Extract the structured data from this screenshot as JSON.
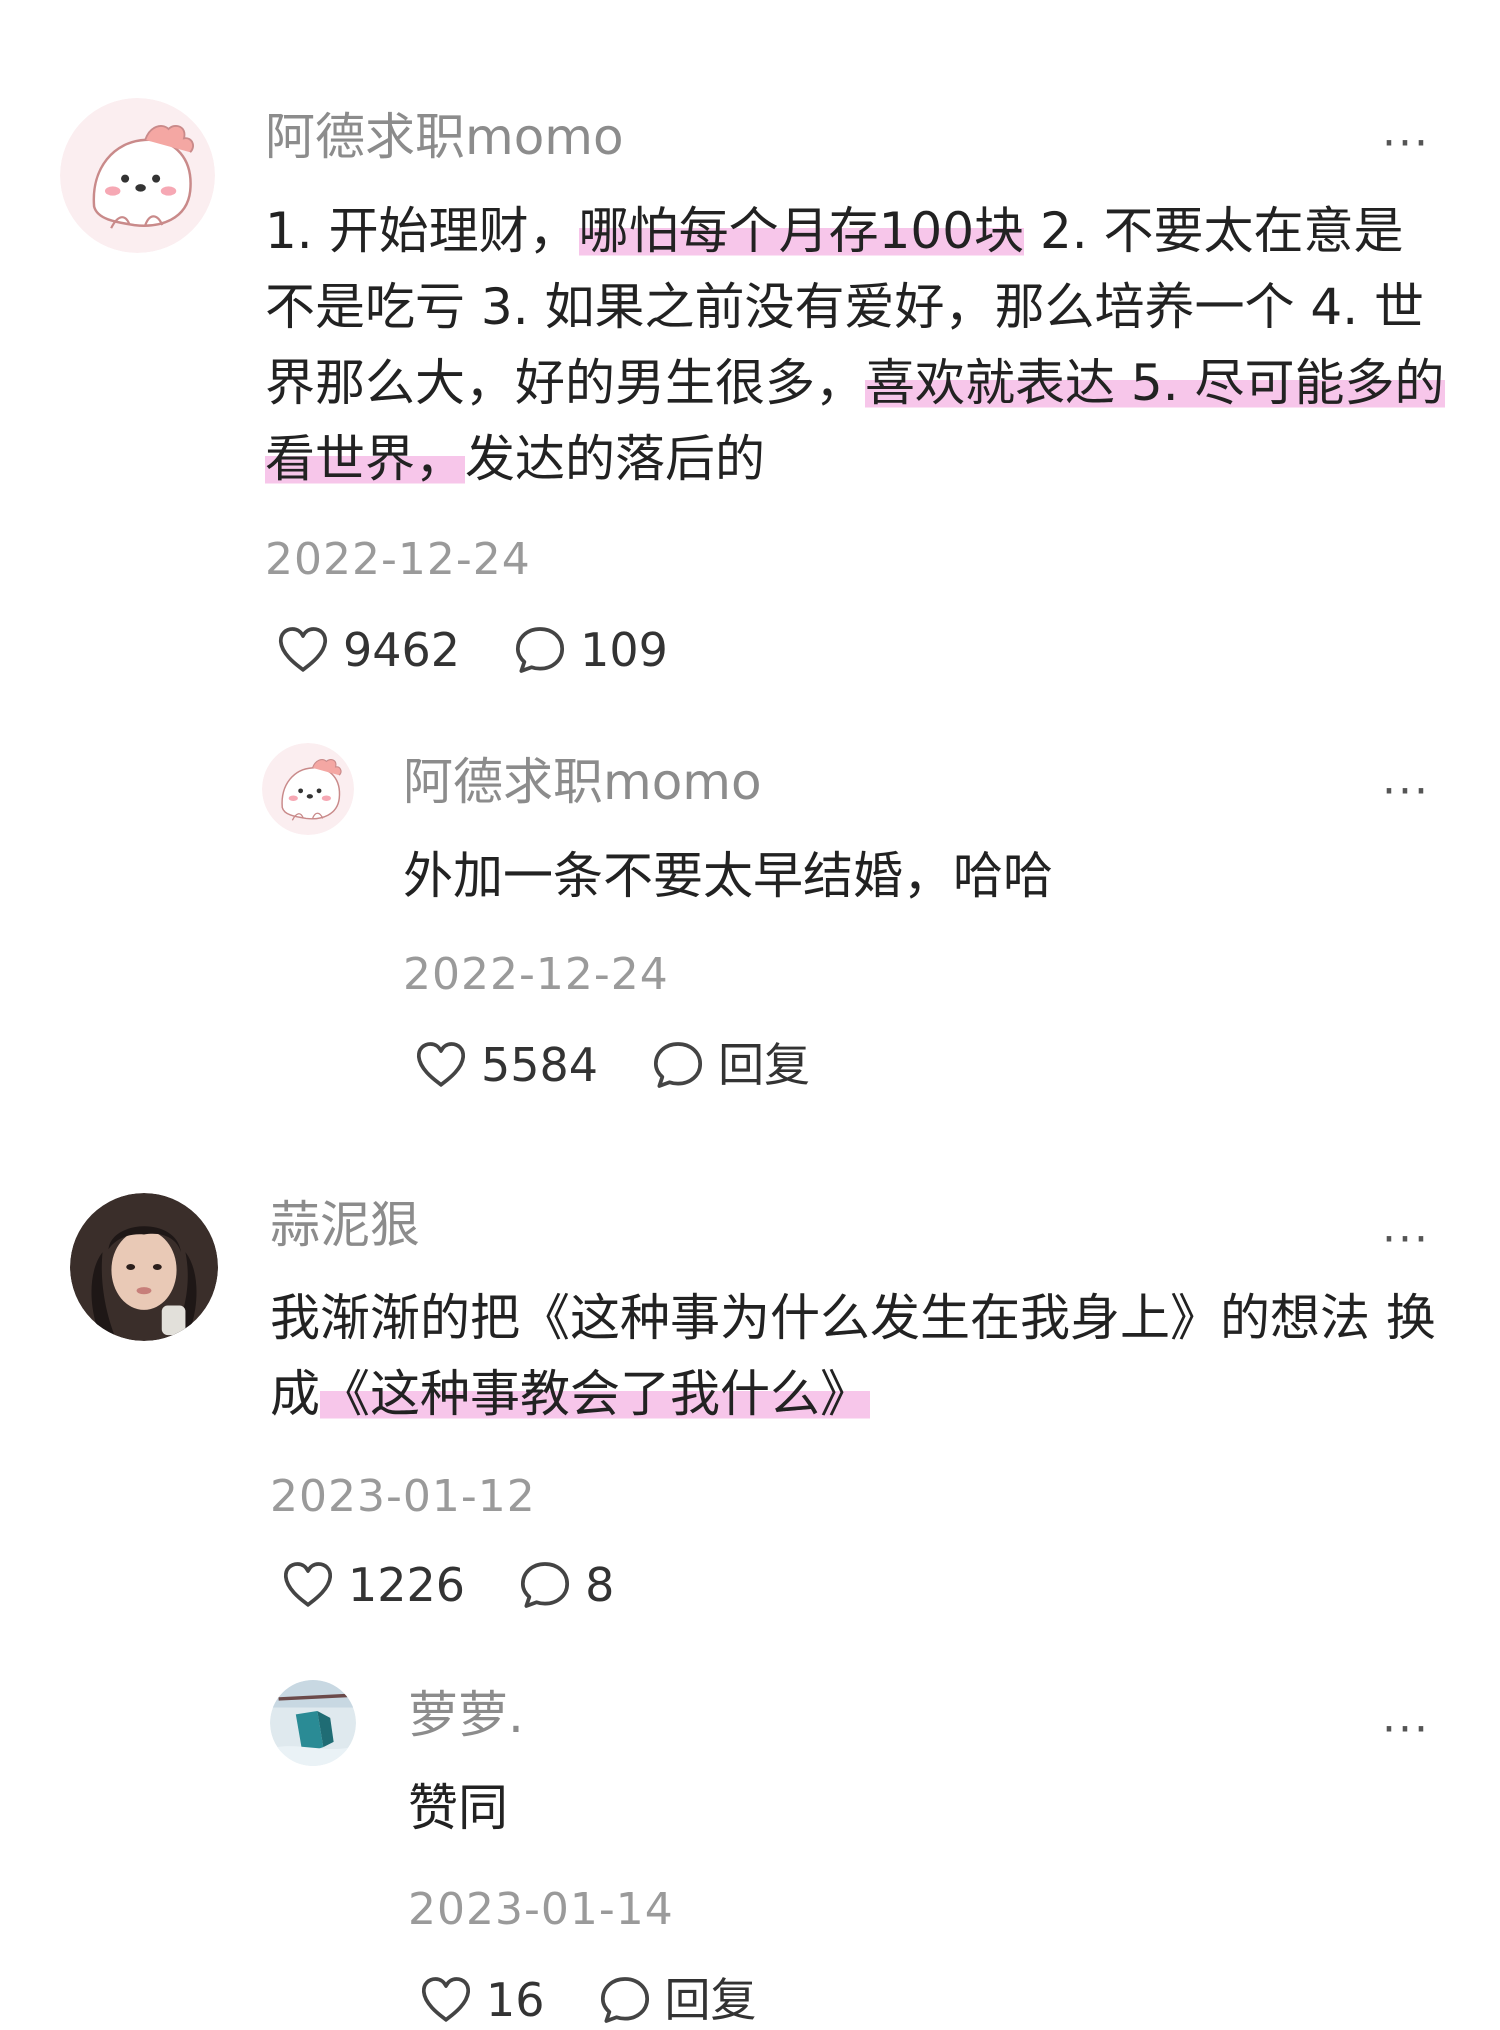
{
  "comments": [
    {
      "username": "阿德求职momo",
      "more": "···",
      "content": [
        {
          "text": "1. 开始理财，",
          "hl": false
        },
        {
          "text": "哪怕每个月存100块",
          "hl": true
        },
        {
          "text": " 2. 不要太在意是不是吃亏 3. 如果之前没有爱好，那么培养一个 4. 世界那么大，好的男生很多，",
          "hl": false
        },
        {
          "text": "喜欢就表达 5. 尽可能多的看世界，",
          "hl": true
        },
        {
          "text": "发达的落后的",
          "hl": false
        }
      ],
      "date": "2022-12-24",
      "likes": "9462",
      "replies": "109",
      "avatar": "pink-dino"
    },
    {
      "username": "阿德求职momo",
      "more": "···",
      "content": [
        {
          "text": "外加一条不要太早结婚，哈哈",
          "hl": false
        }
      ],
      "date": "2022-12-24",
      "likes": "5584",
      "replies": "回复",
      "avatar": "pink-dino"
    },
    {
      "username": "蒜泥狠",
      "more": "···",
      "content": [
        {
          "text": "我渐渐的把《这种事为什么发生在我身上》的想法 换成",
          "hl": false
        },
        {
          "text": "《这种事教会了我什么》",
          "hl": true
        }
      ],
      "date": "2023-01-12",
      "likes": "1226",
      "replies": "8",
      "avatar": "girl-photo"
    },
    {
      "username": "萝萝.",
      "more": "···",
      "content": [
        {
          "text": "赞同",
          "hl": false
        }
      ],
      "date": "2023-01-14",
      "likes": "16",
      "replies": "回复",
      "avatar": "teal-photo"
    }
  ],
  "colors": {
    "highlight": "#f7c6ea",
    "username": "#8c8c8c",
    "date": "#9a9a9a",
    "text": "#222222"
  }
}
